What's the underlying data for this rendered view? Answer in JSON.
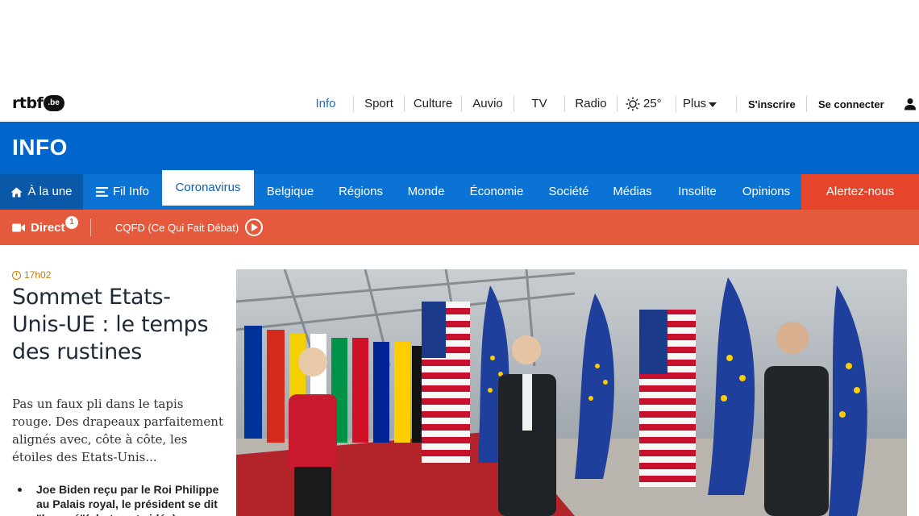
{
  "brand": {
    "logo_text": "rtbf",
    "logo_suffix": ".be"
  },
  "topnav": {
    "items": [
      "Info",
      "Sport",
      "Culture",
      "Auvio",
      "TV",
      "Radio"
    ],
    "weather": "25°",
    "plus": "Plus",
    "register": "S'inscrire",
    "login": "Se connecter"
  },
  "section": {
    "title": "INFO"
  },
  "categories": {
    "home": "À la une",
    "filinfo": "Fil Info",
    "items": [
      "Coronavirus",
      "Belgique",
      "Régions",
      "Monde",
      "Économie",
      "Société",
      "Médias",
      "Insolite",
      "Opinions"
    ],
    "alert": "Alertez-nous"
  },
  "direct": {
    "label": "Direct",
    "count": "1",
    "program": "CQFD (Ce Qui Fait Débat)"
  },
  "article": {
    "time": "17h02",
    "headline": "Sommet Etats-Unis-UE : le temps des rustines",
    "lead": "Pas un faux pli dans le tapis rouge. Des drapeaux parfaitement alignés avec, côte à côte, les étoiles des Etats-Unis...",
    "related": "Joe Biden reçu par le Roi Philippe au Palais royal, le président se dit \"honoré\"(photos et vidéo)"
  },
  "colors": {
    "brand_blue": "#0066cc",
    "nav_blue": "#0a73d4",
    "direct_orange": "#e55a3c",
    "alert_red": "#e5452b",
    "time_orange": "#c77a00"
  }
}
